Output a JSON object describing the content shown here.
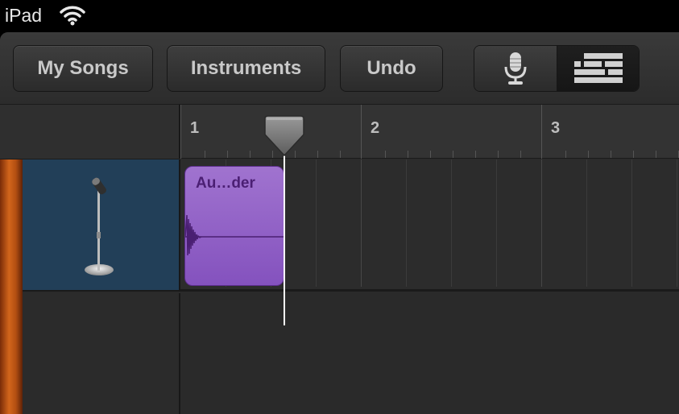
{
  "status_bar": {
    "device": "iPad",
    "wifi_icon": "wifi-icon"
  },
  "toolbar": {
    "my_songs_label": "My Songs",
    "instruments_label": "Instruments",
    "undo_label": "Undo",
    "mic_icon": "microphone-icon",
    "tracks_icon": "tracks-view-icon",
    "tracks_view_selected": true
  },
  "ruler": {
    "bars": [
      "1",
      "2",
      "3"
    ]
  },
  "tracks": [
    {
      "instrument_icon": "microphone-stand-icon",
      "color": "#223f58",
      "region": {
        "label": "Au…der",
        "color": "#8a5ac4"
      }
    }
  ],
  "colors": {
    "track_stripe": "#c85a16",
    "region_purple": "#8a5ac4",
    "header_blue": "#223f58"
  }
}
